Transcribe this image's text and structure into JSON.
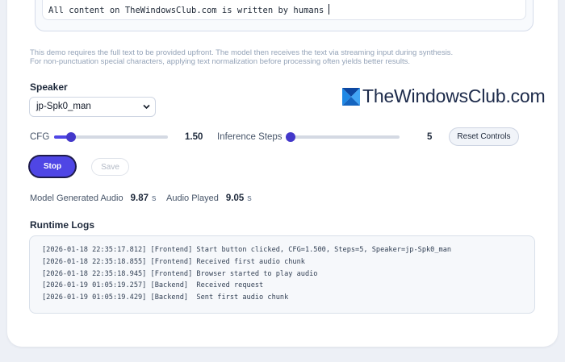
{
  "text_input": {
    "value": "All content on TheWindowsClub.com is written by humans"
  },
  "hints": [
    "This demo requires the full text to be provided upfront. The model then receives the text via streaming input during synthesis.",
    "For non-punctuation special characters, applying text normalization before processing often yields better results."
  ],
  "speaker": {
    "label": "Speaker",
    "selected": "jp-Spk0_man"
  },
  "controls": {
    "cfg": {
      "label": "CFG",
      "value": "1.50",
      "fraction": 0.15
    },
    "inference_steps": {
      "label": "Inference Steps",
      "value": "5",
      "fraction": 0.03
    },
    "reset_label": "Reset Controls"
  },
  "actions": {
    "stop_label": "Stop",
    "save_label": "Save"
  },
  "metrics": {
    "generated": {
      "label": "Model Generated Audio",
      "value": "9.87",
      "unit": "s"
    },
    "played": {
      "label": "Audio Played",
      "value": "9.05",
      "unit": "s"
    }
  },
  "runtime_logs": {
    "title": "Runtime Logs",
    "lines": [
      "[2026-01-18 22:35:17.812] [Frontend] Start button clicked, CFG=1.500, Steps=5, Speaker=jp-Spk0_man",
      "[2026-01-18 22:35:18.855] [Frontend] Received first audio chunk",
      "[2026-01-18 22:35:18.945] [Frontend] Browser started to play audio",
      "[2026-01-19 01:05:19.257] [Backend]  Received request",
      "[2026-01-19 01:05:19.429] [Backend]  Sent first audio chunk"
    ]
  },
  "watermark": {
    "text": "TheWindowsClub.com",
    "logo_icon": "thewindowsclub-logo-icon"
  },
  "colors": {
    "accent": "#4f46e5",
    "background": "#edf0f6"
  }
}
